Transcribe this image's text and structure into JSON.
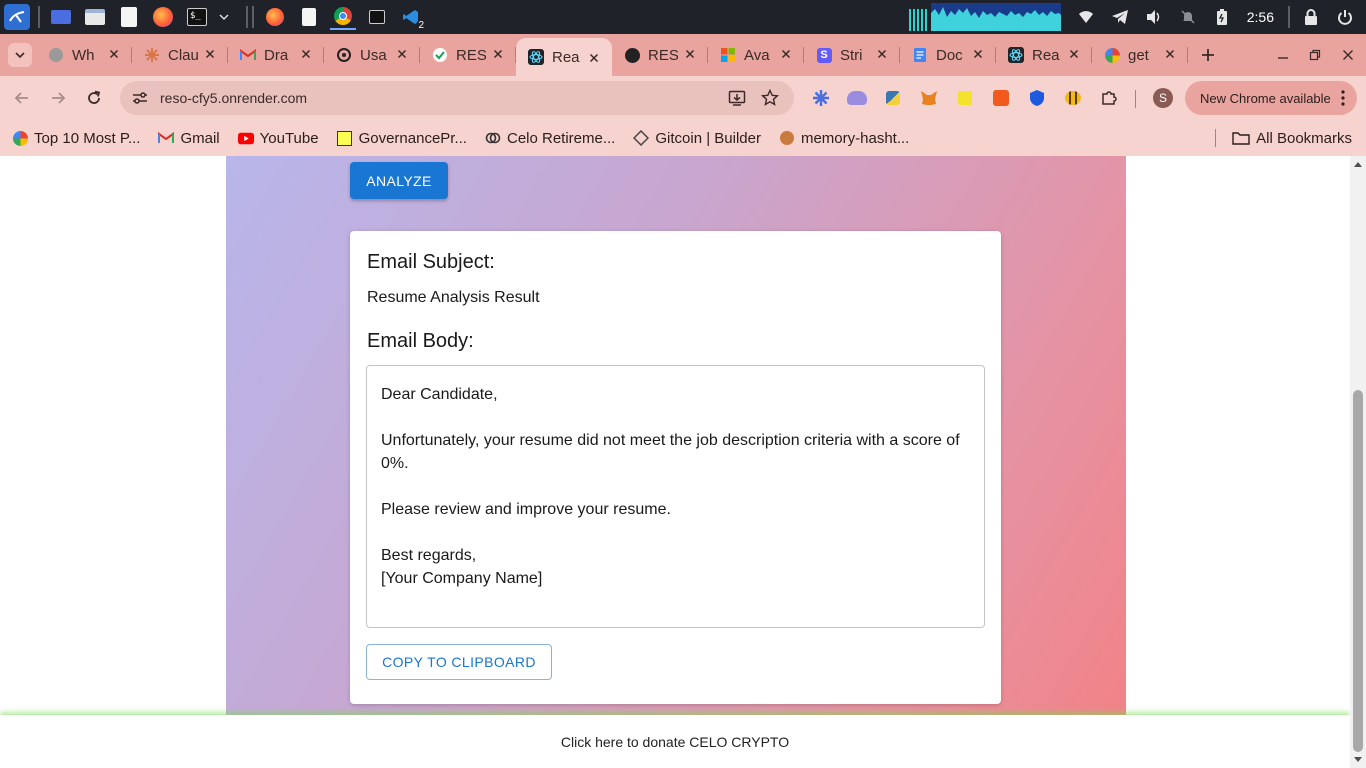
{
  "os_panel": {
    "clock": "2:56",
    "taskbar_badge": "2"
  },
  "tabs": [
    {
      "label": "Wh",
      "icon": "whatsapp-icon"
    },
    {
      "label": "Clau",
      "icon": "claude-icon"
    },
    {
      "label": "Dra",
      "icon": "gmail-icon"
    },
    {
      "label": "Usa",
      "icon": "openai-icon"
    },
    {
      "label": "RES",
      "icon": "checkmark-icon"
    },
    {
      "label": "Rea",
      "icon": "react-icon",
      "active": true
    },
    {
      "label": "RES",
      "icon": "github-icon"
    },
    {
      "label": "Ava",
      "icon": "microsoft-icon"
    },
    {
      "label": "Stri",
      "icon": "stripe-icon"
    },
    {
      "label": "Doc",
      "icon": "docs-icon"
    },
    {
      "label": "Rea",
      "icon": "react-icon"
    },
    {
      "label": "get",
      "icon": "google-icon"
    }
  ],
  "toolbar": {
    "url": "reso-cfy5.onrender.com",
    "profile_initial": "S",
    "update_label": "New Chrome available"
  },
  "bookmarks": [
    {
      "label": "Top 10 Most P...",
      "icon": "google-icon"
    },
    {
      "label": "Gmail",
      "icon": "gmail-icon"
    },
    {
      "label": "YouTube",
      "icon": "youtube-icon"
    },
    {
      "label": "GovernancePr...",
      "icon": "celo-icon"
    },
    {
      "label": "Celo Retireme...",
      "icon": "celo-ring-icon"
    },
    {
      "label": "Gitcoin | Builder",
      "icon": "gitcoin-icon"
    },
    {
      "label": "memory-hasht...",
      "icon": "fox-icon"
    }
  ],
  "bookmarks_all": "All Bookmarks",
  "page": {
    "analyze_label": "ANALYZE",
    "subject_heading": "Email Subject:",
    "subject_value": "Resume Analysis Result",
    "body_heading": "Email Body:",
    "body_text": "Dear Candidate,\n\nUnfortunately, your resume did not meet the job description criteria with a score of 0%.\n\nPlease review and improve your resume.\n\nBest regards,\n[Your Company Name]",
    "copy_label": "COPY TO CLIPBOARD",
    "footer_link": "Click here to donate CELO CRYPTO"
  },
  "colors": {
    "primary": "#1976d2",
    "tabstrip": "#e9a49f",
    "toolbar": "#f6d3ce"
  }
}
